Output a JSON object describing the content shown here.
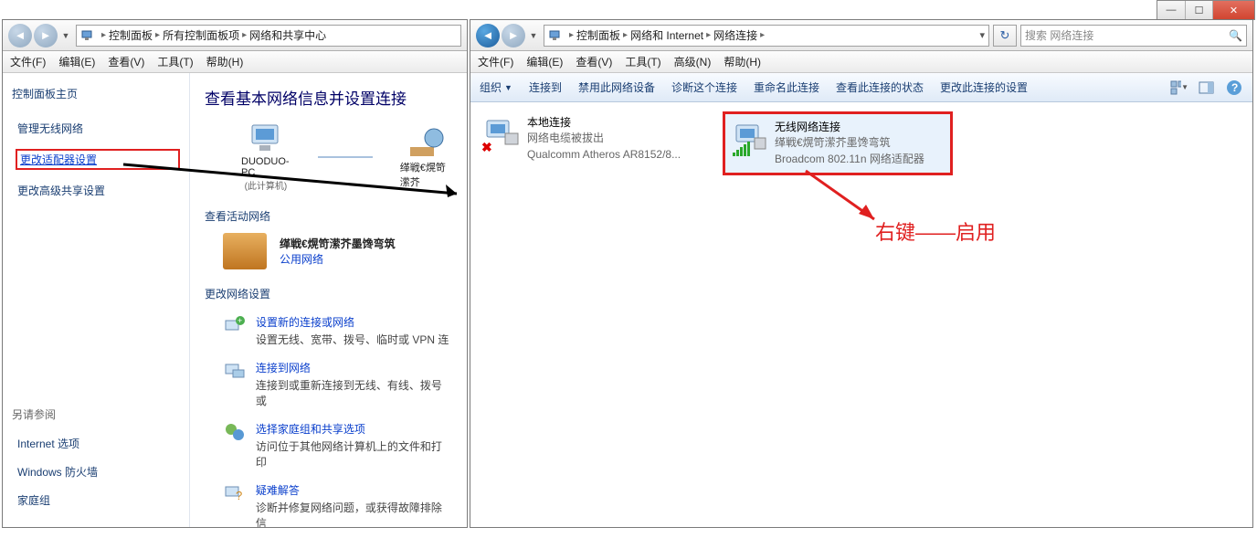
{
  "win_controls": {
    "min": "—",
    "max": "☐",
    "close": "✕"
  },
  "left": {
    "breadcrumbs": [
      "控制面板",
      "所有控制面板项",
      "网络和共享中心"
    ],
    "menus": [
      "文件(F)",
      "编辑(E)",
      "查看(V)",
      "工具(T)",
      "帮助(H)"
    ],
    "sidebar": {
      "title": "控制面板主页",
      "links": [
        "管理无线网络",
        "更改适配器设置",
        "更改高级共享设置"
      ],
      "seealso_label": "另请参阅",
      "seealso": [
        "Internet 选项",
        "Windows 防火墙",
        "家庭组"
      ]
    },
    "content": {
      "heading": "查看基本网络信息并设置连接",
      "node1": "DUODUO-PC",
      "node1_sub": "(此计算机)",
      "node2": "缂戦€熀笴潆芥",
      "active_title": "查看活动网络",
      "active_name": "缂戦€熀笴潆芥墨馋弯筑",
      "active_type": "公用网络",
      "change_title": "更改网络设置",
      "items": [
        {
          "title": "设置新的连接或网络",
          "desc": "设置无线、宽带、拨号、临时或 VPN 连"
        },
        {
          "title": "连接到网络",
          "desc": "连接到或重新连接到无线、有线、拨号或"
        },
        {
          "title": "选择家庭组和共享选项",
          "desc": "访问位于其他网络计算机上的文件和打印"
        },
        {
          "title": "疑难解答",
          "desc": "诊断并修复网络问题，或获得故障排除信"
        }
      ]
    }
  },
  "right": {
    "breadcrumbs": [
      "控制面板",
      "网络和 Internet",
      "网络连接"
    ],
    "search_placeholder": "搜索 网络连接",
    "menus": [
      "文件(F)",
      "编辑(E)",
      "查看(V)",
      "工具(T)",
      "高级(N)",
      "帮助(H)"
    ],
    "toolbar": [
      "组织",
      "连接到",
      "禁用此网络设备",
      "诊断这个连接",
      "重命名此连接",
      "查看此连接的状态",
      "更改此连接的设置"
    ],
    "connections": [
      {
        "name": "本地连接",
        "status": "网络电缆被拔出",
        "device": "Qualcomm Atheros AR8152/8..."
      },
      {
        "name": "无线网络连接",
        "status": "缂戦€熀笴潆芥墨馋弯筑",
        "device": "Broadcom 802.11n 网络适配器"
      }
    ]
  },
  "annotation": "右键——启用"
}
